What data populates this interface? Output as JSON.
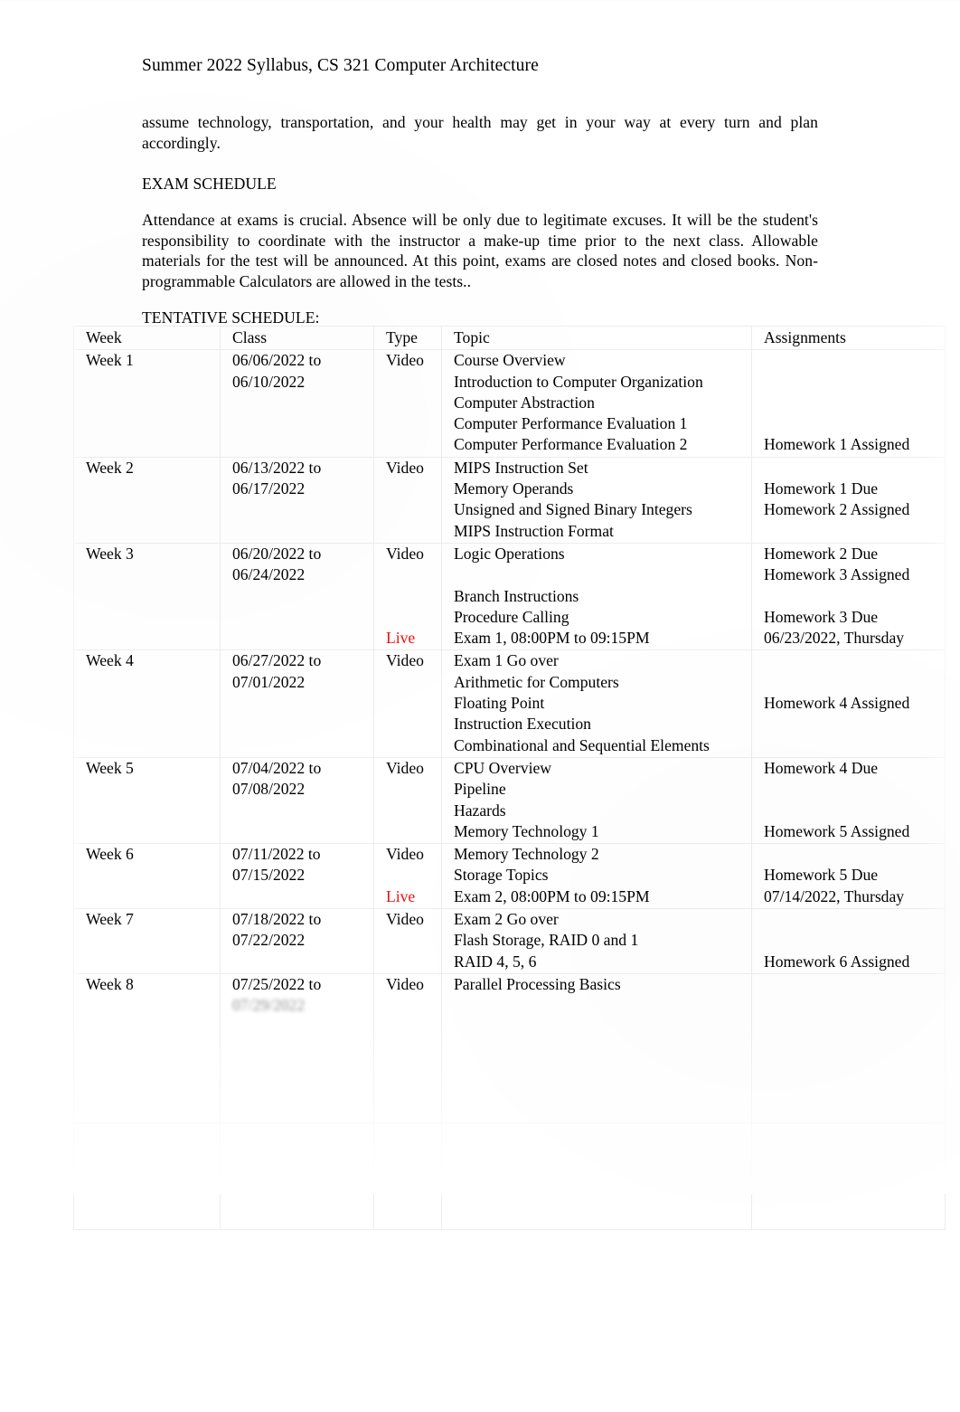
{
  "document": {
    "running_header": "Summer 2022 Syllabus, CS 321 Computer Architecture",
    "paragraphs": {
      "assume": "assume technology, transportation, and your health may get in your way at every turn and plan accordingly.",
      "exam_schedule_heading": "EXAM SCHEDULE",
      "attendance": "Attendance at exams is crucial.  Absence will be only due to legitimate excuses.  It will be the student's responsibility to coordinate with the instructor a make-up time prior to the next class.    Allowable materials for the test will be announced.   At this point, exams are closed notes and closed books. Non-programmable Calculators are allowed in the tests..",
      "tentative_schedule_heading": "TENTATIVE SCHEDULE:"
    }
  },
  "colors": {
    "live_red": "#ee1111",
    "text": "#000000",
    "grid": "#ededed"
  },
  "schedule": {
    "columns": [
      "Week",
      "Class",
      "Type",
      "Topic",
      "Assignments"
    ],
    "rows": [
      {
        "week": "Week 1",
        "class": [
          "06/06/2022 to",
          "06/10/2022"
        ],
        "type": [
          "Video"
        ],
        "topic": [
          "Course Overview",
          "Introduction to Computer Organization",
          "Computer Abstraction",
          "Computer Performance Evaluation 1",
          "Computer Performance Evaluation 2"
        ],
        "assignments": [
          "",
          "",
          "",
          "",
          "Homework 1 Assigned"
        ]
      },
      {
        "week": "Week 2",
        "class": [
          "06/13/2022 to",
          "06/17/2022"
        ],
        "type": [
          "Video"
        ],
        "topic": [
          "MIPS Instruction Set",
          "Memory Operands",
          "Unsigned and Signed Binary Integers",
          "MIPS Instruction Format"
        ],
        "assignments": [
          "",
          "Homework 1 Due",
          "Homework 2 Assigned",
          ""
        ]
      },
      {
        "week": "Week 3",
        "class": [
          "06/20/2022 to",
          "06/24/2022"
        ],
        "type": [
          "Video",
          "",
          "",
          "",
          "Live"
        ],
        "type_live_index": 4,
        "topic": [
          "Logic Operations",
          "",
          "Branch Instructions",
          "Procedure Calling",
          "Exam 1, 08:00PM to 09:15PM"
        ],
        "assignments": [
          "Homework 2 Due",
          "Homework 3 Assigned",
          "",
          "Homework 3 Due",
          "06/23/2022, Thursday"
        ]
      },
      {
        "week": "Week 4",
        "class": [
          "06/27/2022 to",
          "07/01/2022"
        ],
        "type": [
          "Video"
        ],
        "topic": [
          "Exam 1 Go over",
          "Arithmetic for Computers",
          "Floating Point",
          "Instruction Execution",
          "Combinational and Sequential Elements"
        ],
        "assignments": [
          "",
          "",
          "Homework 4 Assigned",
          "",
          ""
        ]
      },
      {
        "week": "Week 5",
        "class": [
          "07/04/2022 to",
          "07/08/2022"
        ],
        "type": [
          "Video"
        ],
        "topic": [
          "CPU Overview",
          "Pipeline",
          "Hazards",
          "Memory Technology 1"
        ],
        "assignments": [
          "Homework 4 Due",
          "",
          "",
          "Homework 5 Assigned"
        ]
      },
      {
        "week": "Week 6",
        "class": [
          "07/11/2022 to",
          "07/15/2022"
        ],
        "type": [
          "Video",
          "",
          "Live"
        ],
        "type_live_index": 2,
        "topic": [
          "Memory Technology 2",
          "Storage Topics",
          "Exam 2, 08:00PM to 09:15PM"
        ],
        "assignments": [
          "",
          "Homework 5 Due",
          "07/14/2022, Thursday"
        ]
      },
      {
        "week": "Week 7",
        "class": [
          "07/18/2022 to",
          "07/22/2022"
        ],
        "type": [
          "Video"
        ],
        "topic": [
          "Exam 2 Go over",
          "Flash Storage, RAID 0 and 1",
          "RAID 4, 5, 6"
        ],
        "assignments": [
          "",
          "",
          "Homework 6 Assigned"
        ]
      },
      {
        "week": "Week 8",
        "class": [
          "07/25/2022 to",
          "07/29/2022"
        ],
        "type": [
          "Video",
          "",
          "",
          ""
        ],
        "topic": [
          "Parallel Processing Basics",
          "",
          "",
          ""
        ],
        "assignments": [
          "",
          "",
          "",
          ""
        ],
        "faded": true
      },
      {
        "week": "",
        "class": [
          "",
          ""
        ],
        "type": [
          ""
        ],
        "topic": [
          "",
          ""
        ],
        "assignments": [
          ""
        ],
        "faded": true,
        "illegible": true
      }
    ]
  }
}
